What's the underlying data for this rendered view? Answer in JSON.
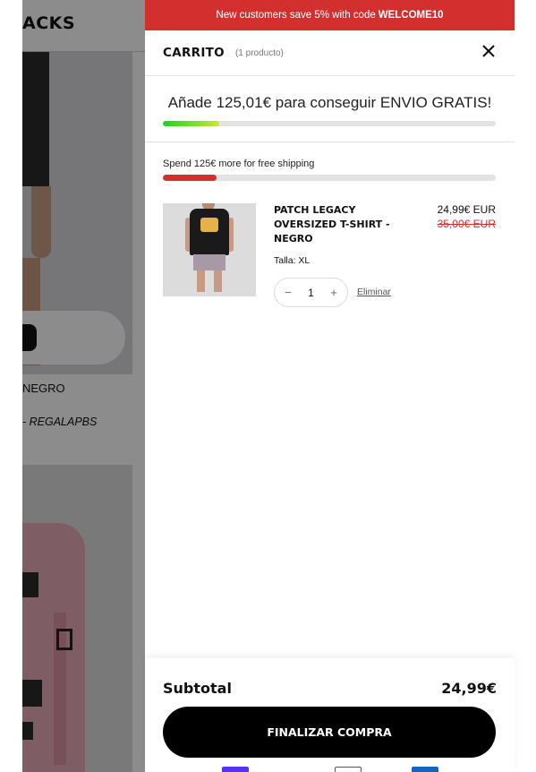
{
  "background": {
    "header_title": "ACKS",
    "product_name": "NEGRO",
    "promo_text": "- REGALAPBS"
  },
  "announcement": {
    "text": "New customers save 5% with code",
    "code": "WELCOME10"
  },
  "cart": {
    "title": "CARRITO",
    "count": "(1 producto)",
    "free_shipping_message": "Añade 125,01€ para conseguir ENVIO GRATIS!",
    "free_shipping_progress": 0.17,
    "spend_message": "Spend 125€ more for free shipping",
    "spend_progress": 0.16,
    "items": [
      {
        "name": "PATCH LEGACY OVERSIZED T-SHIRT - NEGRO",
        "price": "24,99€ EUR",
        "old_price": "35,00€ EUR",
        "variant": "Talla: XL",
        "quantity": "1",
        "remove_label": "Eliminar"
      }
    ],
    "subtotal_label": "Subtotal",
    "subtotal_value": "24,99€",
    "checkout_label": "FINALIZAR COMPRA"
  },
  "colors": {
    "accent_red": "#d32f2f",
    "progress_green": "#1fd11f",
    "button_black": "#000000"
  },
  "icons": {
    "close": "close-icon",
    "minus": "minus-icon",
    "plus": "plus-icon"
  }
}
